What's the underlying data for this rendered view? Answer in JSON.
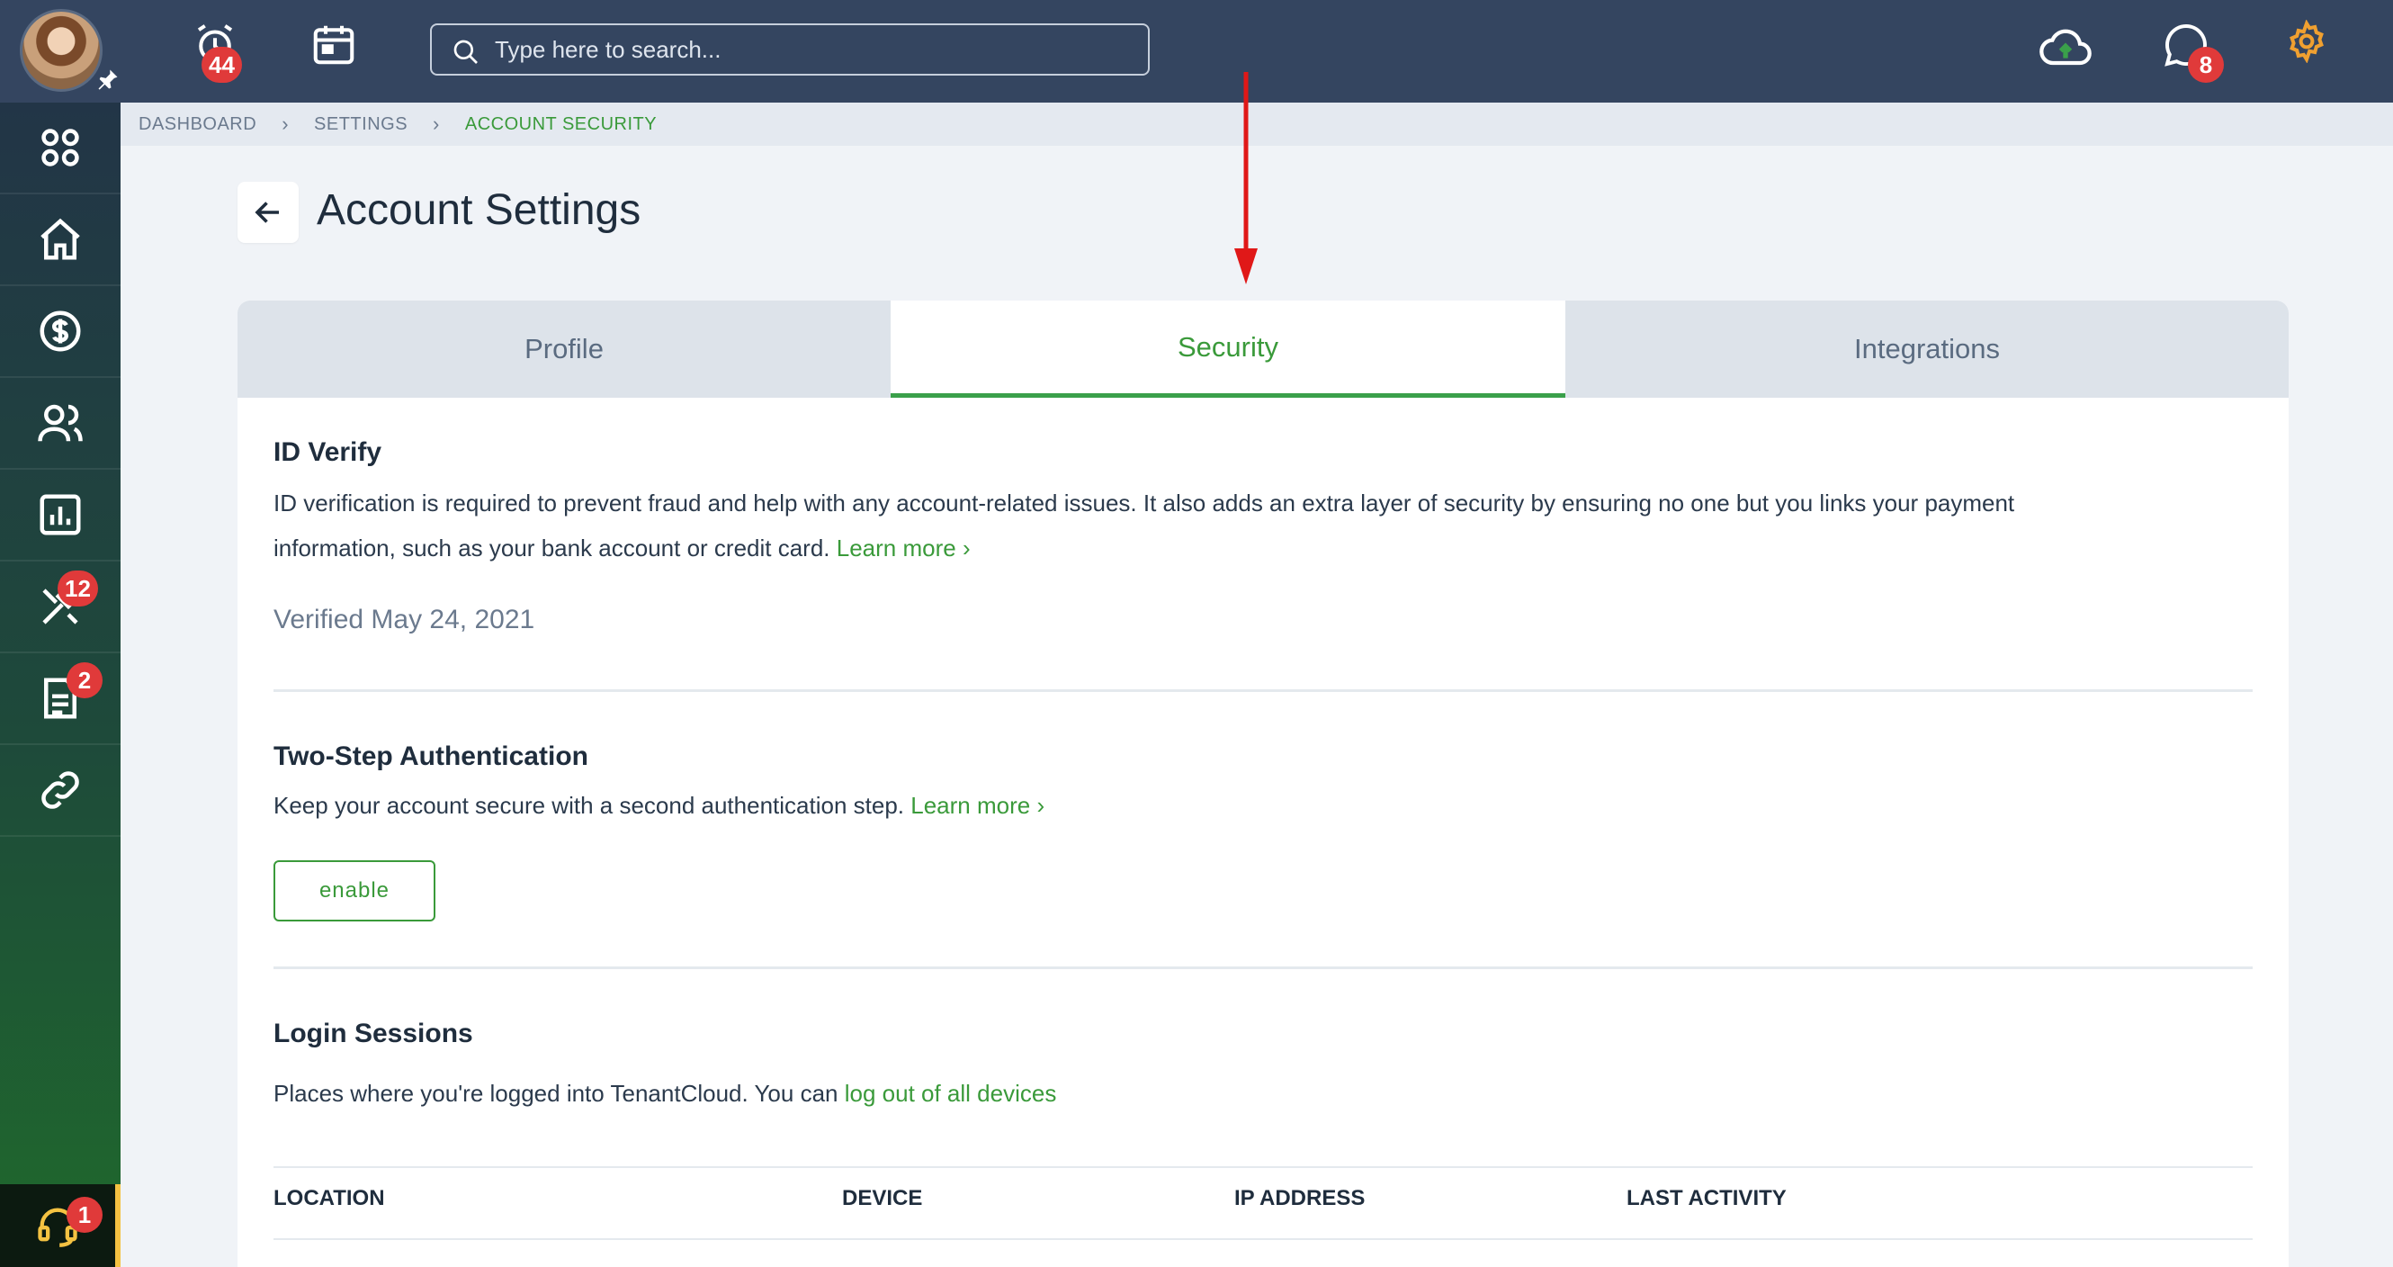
{
  "topbar": {
    "alarm_badge": "44",
    "search_placeholder": "Type here to search...",
    "messages_badge": "8"
  },
  "sidebar": {
    "items": [
      {
        "icon": "apps-grid-icon"
      },
      {
        "icon": "home-icon"
      },
      {
        "icon": "dollar-icon"
      },
      {
        "icon": "users-icon"
      },
      {
        "icon": "reports-icon"
      },
      {
        "icon": "tools-icon",
        "badge": "12"
      },
      {
        "icon": "document-icon",
        "badge": "2"
      },
      {
        "icon": "link-icon"
      }
    ],
    "support_badge": "1"
  },
  "breadcrumb": {
    "items": [
      "DASHBOARD",
      "SETTINGS",
      "ACCOUNT SECURITY"
    ]
  },
  "page": {
    "title": "Account Settings"
  },
  "tabs": [
    {
      "label": "Profile"
    },
    {
      "label": "Security"
    },
    {
      "label": "Integrations"
    }
  ],
  "id_verify": {
    "title": "ID Verify",
    "line1": "ID verification is required to prevent fraud and help with any account-related issues. It also adds an extra layer of security by ensuring no one but you links your payment",
    "line2": "information, such as your bank account or credit card.",
    "learn_more": "Learn more",
    "status": "Verified May 24, 2021"
  },
  "two_step": {
    "title": "Two-Step Authentication",
    "text": "Keep your account secure with a second authentication step.",
    "learn_more": "Learn more",
    "button": "enable"
  },
  "login_sessions": {
    "title": "Login Sessions",
    "text": "Places where you're logged into TenantCloud. You can",
    "link": "log out of all devices",
    "columns": [
      "LOCATION",
      "DEVICE",
      "IP ADDRESS",
      "LAST ACTIVITY"
    ]
  },
  "colors": {
    "accent": "#3a9a3a",
    "topbar": "#344560",
    "badge": "#e03a3a"
  }
}
